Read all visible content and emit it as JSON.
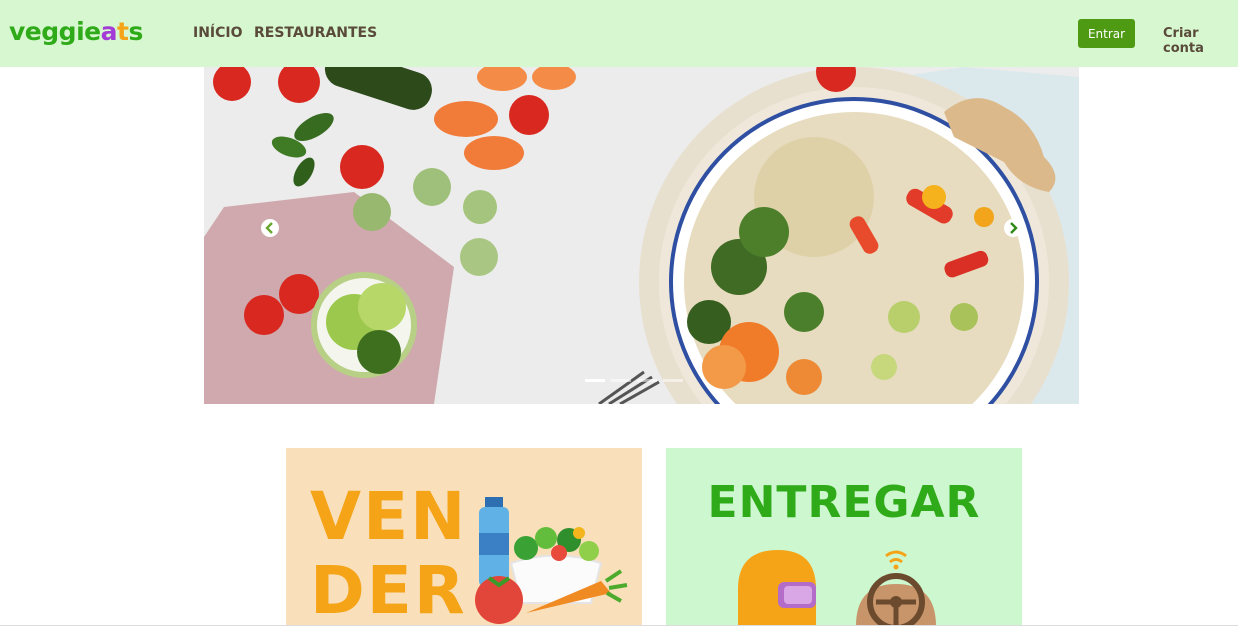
{
  "brand": {
    "letters": [
      {
        "char": "v",
        "color": "#2faa18"
      },
      {
        "char": "e",
        "color": "#2faa18"
      },
      {
        "char": "g",
        "color": "#2faa18"
      },
      {
        "char": "g",
        "color": "#2faa18"
      },
      {
        "char": "i",
        "color": "#2faa18"
      },
      {
        "char": "e",
        "color": "#2faa18"
      },
      {
        "char": "a",
        "color": "#a33bd6"
      },
      {
        "char": "t",
        "color": "#f5a417"
      },
      {
        "char": "s",
        "color": "#2faa18"
      }
    ]
  },
  "nav": {
    "inicio": "INÍCIO",
    "restaurantes": "RESTAURANTES",
    "login": "Entrar",
    "signup": "Criar conta"
  },
  "carousel": {
    "icons": {
      "prev": "chevron-left-icon",
      "next": "chevron-right-icon"
    },
    "slide_count": 4,
    "active_index": 0
  },
  "cards": {
    "vender": {
      "line1": "VEN",
      "line2": "DER"
    },
    "entregar": {
      "title": "ENTREGAR"
    }
  },
  "colors": {
    "nav_bg": "#d6f7cf",
    "primary_button": "#4f9a13",
    "brand_green": "#2faa18",
    "brand_purple": "#a33bd6",
    "brand_orange": "#f5a417",
    "card_vender_bg": "#f9e0bb",
    "card_entregar_bg": "#cdf7cf"
  }
}
